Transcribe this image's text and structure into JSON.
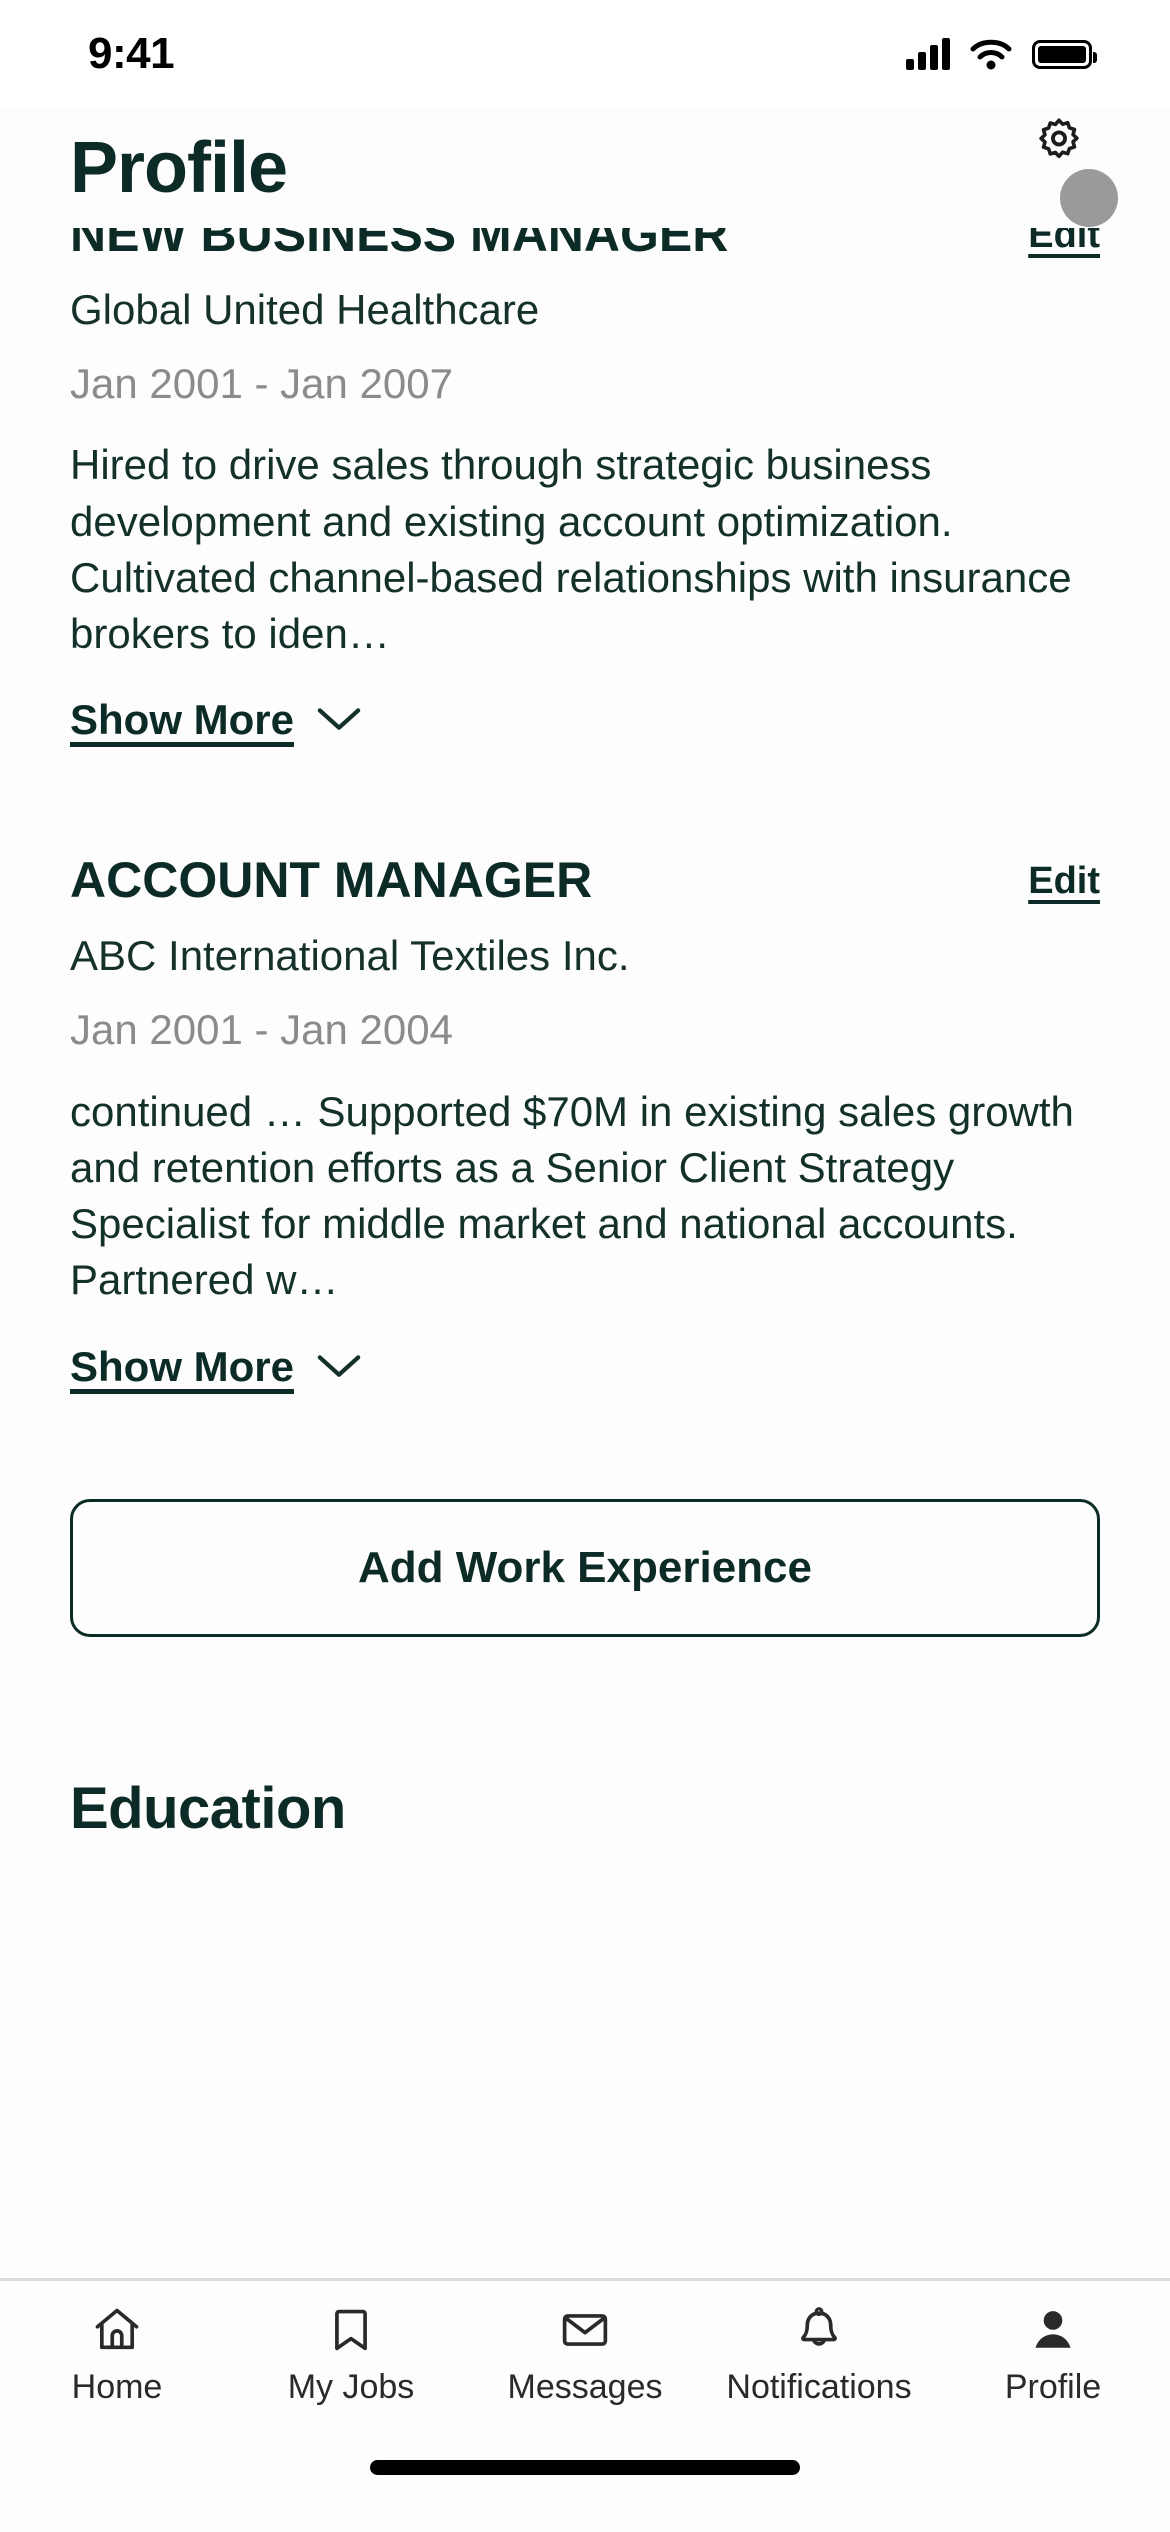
{
  "status_bar": {
    "time": "9:41",
    "cellular_icon": "signal-bars-icon",
    "wifi_icon": "wifi-icon",
    "battery_icon": "battery-full-icon"
  },
  "header": {
    "title": "Profile",
    "settings_icon": "gear-icon",
    "avatar_icon": "avatar-circle"
  },
  "work_experience": {
    "jobs": [
      {
        "title": "NEW BUSINESS MANAGER",
        "edit_label": "Edit",
        "company": "Global United Healthcare",
        "dates": "Jan 2001 - Jan 2007",
        "description": "Hired to drive sales through strategic business development and existing account optimization. Cultivated channel-based relationships with insurance brokers to iden…",
        "show_more_label": "Show More",
        "chevron_icon": "chevron-down-icon"
      },
      {
        "title": "ACCOUNT MANAGER",
        "edit_label": "Edit",
        "company": "ABC International Textiles Inc.",
        "dates": "Jan 2001 - Jan 2004",
        "description": "continued … Supported $70M in existing sales growth and retention efforts as a Senior Client Strategy Specialist for middle market  and national accounts. Partnered w…",
        "show_more_label": "Show More",
        "chevron_icon": "chevron-down-icon"
      }
    ],
    "add_button_label": "Add Work Experience"
  },
  "education": {
    "section_title": "Education"
  },
  "bottom_nav": {
    "items": [
      {
        "label": "Home",
        "icon": "home-icon",
        "active": false
      },
      {
        "label": "My Jobs",
        "icon": "bookmark-icon",
        "active": false
      },
      {
        "label": "Messages",
        "icon": "envelope-icon",
        "active": false
      },
      {
        "label": "Notifications",
        "icon": "bell-icon",
        "active": false
      },
      {
        "label": "Profile",
        "icon": "person-filled-icon",
        "active": true
      }
    ]
  },
  "colors": {
    "brand_dark_green": "#0d2b26",
    "muted_gray": "#8b8b8b",
    "background": "#fcfdfc",
    "nav_border": "#d8dbd9",
    "avatar_gray": "#9a9a9a"
  }
}
